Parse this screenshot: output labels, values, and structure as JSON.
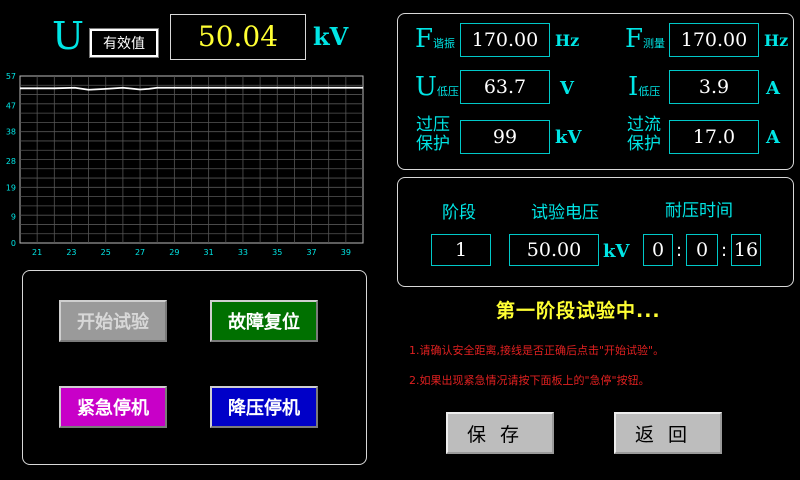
{
  "header": {
    "symbol": "U",
    "mode_button": "有效值",
    "value": "50.04",
    "unit": "kV"
  },
  "chart_data": {
    "type": "line",
    "yticks": [
      0,
      9,
      19,
      28,
      38,
      47,
      57
    ],
    "xticks": [
      21,
      23,
      25,
      27,
      29,
      31,
      33,
      35,
      37,
      39
    ],
    "ylim": [
      0,
      57
    ],
    "xlim": [
      20,
      40
    ],
    "grid": true,
    "series": [
      {
        "x": [
          20,
          22,
          23.2,
          24,
          25,
          26,
          27,
          27.5,
          28,
          30,
          40
        ],
        "y": [
          52.8,
          52.8,
          53.0,
          52.3,
          52.6,
          53.0,
          52.4,
          52.6,
          53.0,
          53.0,
          53.0
        ]
      }
    ]
  },
  "params": {
    "f_res": {
      "letter": "F",
      "sub": "谐振",
      "value": "170.00",
      "unit": "Hz"
    },
    "f_meas": {
      "letter": "F",
      "sub": "测量",
      "value": "170.00",
      "unit": "Hz"
    },
    "u_low": {
      "letter": "U",
      "sub": "低压",
      "value": "63.7",
      "unit": "V"
    },
    "i_low": {
      "letter": "I",
      "sub": "低压",
      "value": "3.9",
      "unit": "A"
    },
    "ov_prot": {
      "label1": "过压",
      "label2": "保护",
      "value": "99",
      "unit": "kV"
    },
    "oc_prot": {
      "label1": "过流",
      "label2": "保护",
      "value": "17.0",
      "unit": "A"
    }
  },
  "stage": {
    "h_stage": "阶段",
    "h_voltage": "试验电压",
    "h_time": "耐压时间",
    "stage_value": "1",
    "voltage_value": "50.00",
    "voltage_unit": "kV",
    "hh": "0",
    "mm": "0",
    "ss": "16",
    "sep": ":"
  },
  "controls": {
    "start": "开始试验",
    "reset": "故障复位",
    "estop": "紧急停机",
    "stepdown": "降压停机"
  },
  "status": {
    "title": "第一阶段试验中...",
    "note1": "1.请确认安全距离,接线是否正确后点击\"开始试验\"。",
    "note2": "2.如果出现紧急情况请按下面板上的\"急停\"按钮。"
  },
  "footer": {
    "save": "保存",
    "back": "返回"
  },
  "colors": {
    "accent": "#00e5e5",
    "value_yellow": "#ffff33",
    "start_bg": "#9a9a9a",
    "reset_bg": "#007000",
    "estop_bg": "#c800c8",
    "stepdown_bg": "#0000c8",
    "note_red": "#e02020"
  }
}
